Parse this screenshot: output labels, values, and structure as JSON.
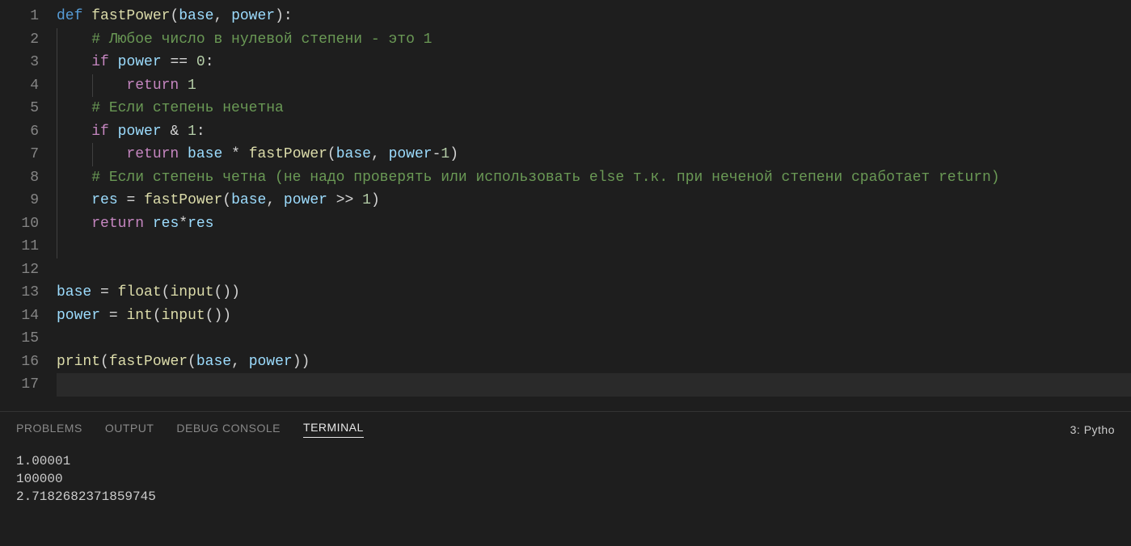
{
  "code": {
    "lines": [
      [
        {
          "cls": "tk-keyword",
          "t": "def"
        },
        {
          "cls": "",
          "t": " "
        },
        {
          "cls": "tk-funcname",
          "t": "fastPower"
        },
        {
          "cls": "tk-punct",
          "t": "("
        },
        {
          "cls": "tk-param",
          "t": "base"
        },
        {
          "cls": "tk-punct",
          "t": ", "
        },
        {
          "cls": "tk-param",
          "t": "power"
        },
        {
          "cls": "tk-punct",
          "t": "):"
        }
      ],
      [
        {
          "cls": "",
          "t": "    "
        },
        {
          "cls": "tk-comment",
          "t": "# Любое число в нулевой степени - это 1"
        }
      ],
      [
        {
          "cls": "",
          "t": "    "
        },
        {
          "cls": "tk-control",
          "t": "if"
        },
        {
          "cls": "",
          "t": " "
        },
        {
          "cls": "tk-var",
          "t": "power"
        },
        {
          "cls": "",
          "t": " "
        },
        {
          "cls": "tk-op",
          "t": "=="
        },
        {
          "cls": "",
          "t": " "
        },
        {
          "cls": "tk-num",
          "t": "0"
        },
        {
          "cls": "tk-punct",
          "t": ":"
        }
      ],
      [
        {
          "cls": "",
          "t": "        "
        },
        {
          "cls": "tk-control",
          "t": "return"
        },
        {
          "cls": "",
          "t": " "
        },
        {
          "cls": "tk-num",
          "t": "1"
        }
      ],
      [
        {
          "cls": "",
          "t": "    "
        },
        {
          "cls": "tk-comment",
          "t": "# Если степень нечетна"
        }
      ],
      [
        {
          "cls": "",
          "t": "    "
        },
        {
          "cls": "tk-control",
          "t": "if"
        },
        {
          "cls": "",
          "t": " "
        },
        {
          "cls": "tk-var",
          "t": "power"
        },
        {
          "cls": "",
          "t": " "
        },
        {
          "cls": "tk-op",
          "t": "&"
        },
        {
          "cls": "",
          "t": " "
        },
        {
          "cls": "tk-num",
          "t": "1"
        },
        {
          "cls": "tk-punct",
          "t": ":"
        }
      ],
      [
        {
          "cls": "",
          "t": "        "
        },
        {
          "cls": "tk-control",
          "t": "return"
        },
        {
          "cls": "",
          "t": " "
        },
        {
          "cls": "tk-var",
          "t": "base"
        },
        {
          "cls": "",
          "t": " "
        },
        {
          "cls": "tk-op",
          "t": "*"
        },
        {
          "cls": "",
          "t": " "
        },
        {
          "cls": "tk-funcname",
          "t": "fastPower"
        },
        {
          "cls": "tk-punct",
          "t": "("
        },
        {
          "cls": "tk-var",
          "t": "base"
        },
        {
          "cls": "tk-punct",
          "t": ", "
        },
        {
          "cls": "tk-var",
          "t": "power"
        },
        {
          "cls": "tk-op",
          "t": "-"
        },
        {
          "cls": "tk-num",
          "t": "1"
        },
        {
          "cls": "tk-punct",
          "t": ")"
        }
      ],
      [
        {
          "cls": "",
          "t": "    "
        },
        {
          "cls": "tk-comment",
          "t": "# Если степень четна (не надо проверять или использовать else т.к. при неченой степени сработает return)"
        }
      ],
      [
        {
          "cls": "",
          "t": "    "
        },
        {
          "cls": "tk-var",
          "t": "res"
        },
        {
          "cls": "",
          "t": " "
        },
        {
          "cls": "tk-op",
          "t": "="
        },
        {
          "cls": "",
          "t": " "
        },
        {
          "cls": "tk-funcname",
          "t": "fastPower"
        },
        {
          "cls": "tk-punct",
          "t": "("
        },
        {
          "cls": "tk-var",
          "t": "base"
        },
        {
          "cls": "tk-punct",
          "t": ", "
        },
        {
          "cls": "tk-var",
          "t": "power"
        },
        {
          "cls": "",
          "t": " "
        },
        {
          "cls": "tk-op",
          "t": ">>"
        },
        {
          "cls": "",
          "t": " "
        },
        {
          "cls": "tk-num",
          "t": "1"
        },
        {
          "cls": "tk-punct",
          "t": ")"
        }
      ],
      [
        {
          "cls": "",
          "t": "    "
        },
        {
          "cls": "tk-control",
          "t": "return"
        },
        {
          "cls": "",
          "t": " "
        },
        {
          "cls": "tk-var",
          "t": "res"
        },
        {
          "cls": "tk-op",
          "t": "*"
        },
        {
          "cls": "tk-var",
          "t": "res"
        }
      ],
      [],
      [],
      [
        {
          "cls": "tk-var",
          "t": "base"
        },
        {
          "cls": "",
          "t": " "
        },
        {
          "cls": "tk-op",
          "t": "="
        },
        {
          "cls": "",
          "t": " "
        },
        {
          "cls": "tk-builtin",
          "t": "float"
        },
        {
          "cls": "tk-punct",
          "t": "("
        },
        {
          "cls": "tk-builtin",
          "t": "input"
        },
        {
          "cls": "tk-punct",
          "t": "())"
        }
      ],
      [
        {
          "cls": "tk-var",
          "t": "power"
        },
        {
          "cls": "",
          "t": " "
        },
        {
          "cls": "tk-op",
          "t": "="
        },
        {
          "cls": "",
          "t": " "
        },
        {
          "cls": "tk-builtin",
          "t": "int"
        },
        {
          "cls": "tk-punct",
          "t": "("
        },
        {
          "cls": "tk-builtin",
          "t": "input"
        },
        {
          "cls": "tk-punct",
          "t": "())"
        }
      ],
      [],
      [
        {
          "cls": "tk-builtin",
          "t": "print"
        },
        {
          "cls": "tk-punct",
          "t": "("
        },
        {
          "cls": "tk-funcname",
          "t": "fastPower"
        },
        {
          "cls": "tk-punct",
          "t": "("
        },
        {
          "cls": "tk-var",
          "t": "base"
        },
        {
          "cls": "tk-punct",
          "t": ", "
        },
        {
          "cls": "tk-var",
          "t": "power"
        },
        {
          "cls": "tk-punct",
          "t": "))"
        }
      ],
      []
    ],
    "indent_guides": [
      [],
      [
        0
      ],
      [
        0
      ],
      [
        0,
        1
      ],
      [
        0
      ],
      [
        0
      ],
      [
        0,
        1
      ],
      [
        0
      ],
      [
        0
      ],
      [
        0
      ],
      [
        0
      ],
      [],
      [],
      [],
      [],
      [],
      []
    ],
    "current_line_index": 16
  },
  "panel": {
    "tabs": [
      {
        "label": "PROBLEMS",
        "active": false
      },
      {
        "label": "OUTPUT",
        "active": false
      },
      {
        "label": "DEBUG CONSOLE",
        "active": false
      },
      {
        "label": "TERMINAL",
        "active": true
      }
    ],
    "right_label": "3: Pytho",
    "terminal_lines": [
      "1.00001",
      "100000",
      "2.7182682371859745"
    ]
  }
}
